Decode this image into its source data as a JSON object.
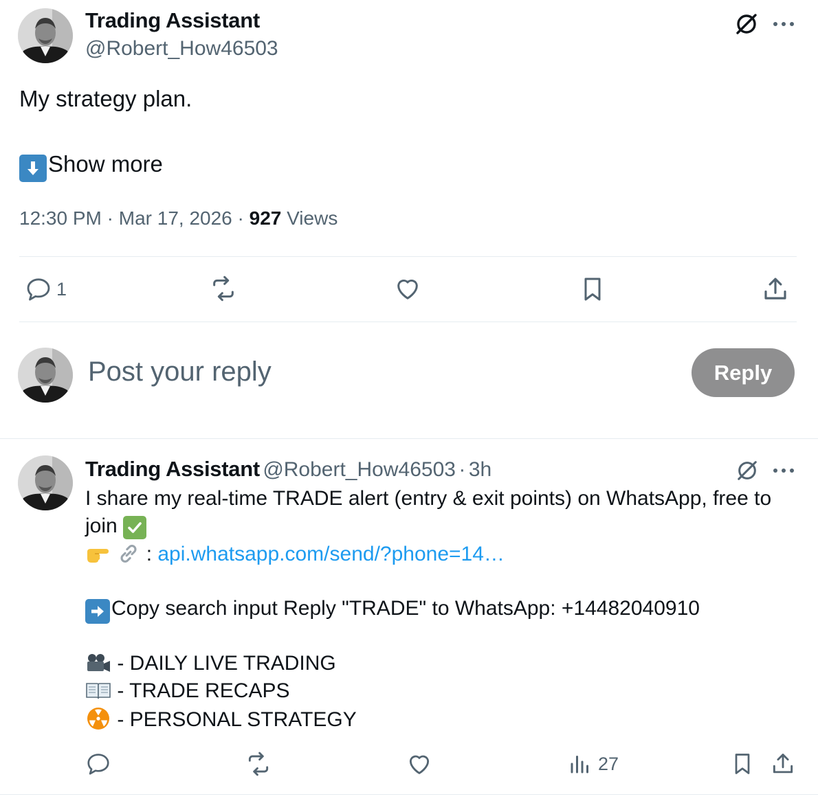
{
  "post": {
    "author_name": "Trading Assistant",
    "author_handle": "@Robert_How46503",
    "text": "My strategy plan.",
    "show_more": "Show more",
    "time": "12:30 PM",
    "date": "Mar 17, 2026",
    "separator": "·",
    "views_count": "927",
    "views_label": "Views",
    "actions": {
      "reply_count": "1"
    }
  },
  "composer": {
    "placeholder": "Post your reply",
    "reply_button": "Reply"
  },
  "reply": {
    "author_name": "Trading Assistant",
    "author_handle": "@Robert_How46503",
    "time_sep": "·",
    "time": "3h",
    "line1": "I share my real-time TRADE alert (entry & exit points) on WhatsApp, free to",
    "line2": "join",
    "link_prefix": ":",
    "link": "api.whatsapp.com/send/?phone=14…",
    "copy_line": "Copy search input  Reply \"TRADE\" to WhatsApp:   +14482040910",
    "list": [
      "- DAILY LIVE TRADING",
      "- TRADE RECAPS",
      "- PERSONAL STRATEGY"
    ],
    "views_count": "27"
  },
  "icons": {
    "grok": "grok-icon",
    "more": "more-icon",
    "reply": "reply-icon",
    "repost": "repost-icon",
    "like": "like-icon",
    "bookmark": "bookmark-icon",
    "share": "share-icon",
    "views": "views-icon"
  },
  "colors": {
    "link": "#1d9bf0",
    "secondary_text": "#536471",
    "reply_button_bg": "#8f8f90",
    "emoji_blue": "#3b88c3",
    "check_green": "#77b255"
  }
}
